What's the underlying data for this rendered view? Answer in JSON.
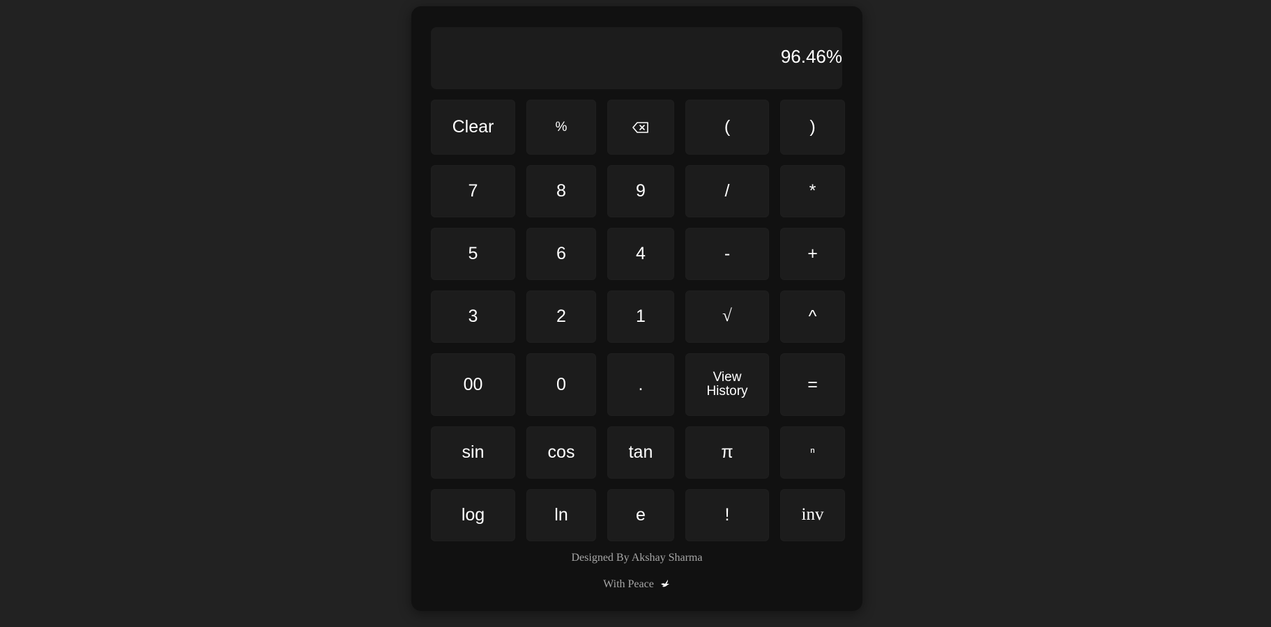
{
  "display": {
    "value": "96.46%"
  },
  "keys": [
    {
      "name": "clear-button",
      "label": "Clear"
    },
    {
      "name": "percent-button",
      "label": "%",
      "style": "small"
    },
    {
      "name": "backspace-button",
      "label": "",
      "icon": "backspace-icon"
    },
    {
      "name": "open-paren-button",
      "label": "("
    },
    {
      "name": "close-paren-button",
      "label": ")"
    },
    {
      "name": "digit-7-button",
      "label": "7"
    },
    {
      "name": "digit-8-button",
      "label": "8"
    },
    {
      "name": "digit-9-button",
      "label": "9"
    },
    {
      "name": "divide-button",
      "label": "/"
    },
    {
      "name": "multiply-button",
      "label": "*"
    },
    {
      "name": "digit-5-button",
      "label": "5"
    },
    {
      "name": "digit-6-button",
      "label": "6"
    },
    {
      "name": "digit-4-button",
      "label": "4"
    },
    {
      "name": "subtract-button",
      "label": "-"
    },
    {
      "name": "add-button",
      "label": "+"
    },
    {
      "name": "digit-3-button",
      "label": "3"
    },
    {
      "name": "digit-2-button",
      "label": "2"
    },
    {
      "name": "digit-1-button",
      "label": "1"
    },
    {
      "name": "sqrt-button",
      "label": "√",
      "style": "serif"
    },
    {
      "name": "power-button",
      "label": "^"
    },
    {
      "name": "double-zero-button",
      "label": "00"
    },
    {
      "name": "digit-0-button",
      "label": "0"
    },
    {
      "name": "decimal-button",
      "label": "."
    },
    {
      "name": "view-history-button",
      "label": "View History",
      "style": "history"
    },
    {
      "name": "equals-button",
      "label": "="
    },
    {
      "name": "sin-button",
      "label": "sin"
    },
    {
      "name": "cos-button",
      "label": "cos"
    },
    {
      "name": "tan-button",
      "label": "tan"
    },
    {
      "name": "pi-button",
      "label": "π"
    },
    {
      "name": "nth-power-button",
      "label": "ⁿ",
      "style": "small"
    },
    {
      "name": "log-button",
      "label": "log"
    },
    {
      "name": "ln-button",
      "label": "ln"
    },
    {
      "name": "e-button",
      "label": "e"
    },
    {
      "name": "factorial-button",
      "label": "!"
    },
    {
      "name": "inv-button",
      "label": "inv",
      "style": "serif"
    }
  ],
  "footer": {
    "designed_by": "Designed By Akshay Sharma",
    "with_peace": "With Peace",
    "icon": "dove-icon"
  }
}
